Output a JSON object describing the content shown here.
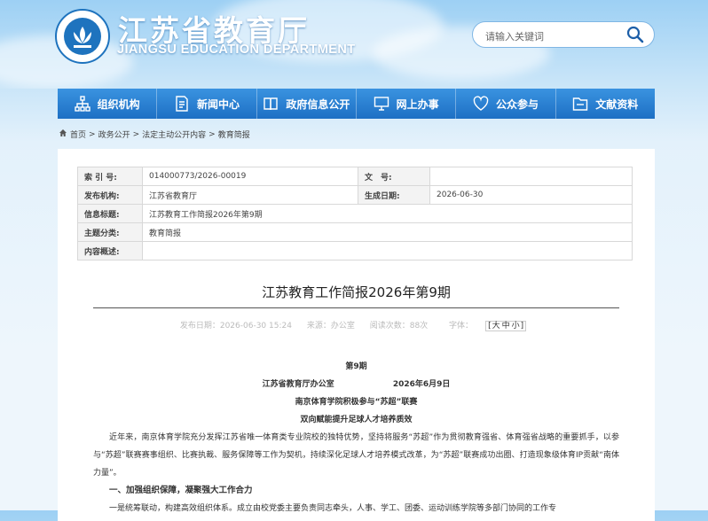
{
  "header": {
    "title": "江苏省教育厅",
    "subtitle": "JIANGSU EDUCATION DEPARTMENT",
    "search_placeholder": "请输入关键词"
  },
  "nav": {
    "items": [
      {
        "label": "组织机构",
        "icon": "org-chart-icon"
      },
      {
        "label": "新闻中心",
        "icon": "document-icon"
      },
      {
        "label": "政府信息公开",
        "icon": "book-icon"
      },
      {
        "label": "网上办事",
        "icon": "monitor-icon"
      },
      {
        "label": "公众参与",
        "icon": "heart-icon"
      },
      {
        "label": "文献资料",
        "icon": "folder-icon"
      }
    ]
  },
  "breadcrumb": [
    "首页",
    "政务公开",
    "法定主动公开内容",
    "教育简报"
  ],
  "meta": {
    "index_label": "索 引 号:",
    "index_value": "014000773/2026-00019",
    "doc_no_label": "文　号:",
    "doc_no_value": "",
    "org_label": "发布机构:",
    "org_value": "江苏省教育厅",
    "date_label": "生成日期:",
    "date_value": "2026-06-30",
    "title_label": "信息标题:",
    "title_value": "江苏教育工作简报2026年第9期",
    "topic_label": "主题分类:",
    "topic_value": "教育简报",
    "summary_label": "内容概述:",
    "summary_value": ""
  },
  "article": {
    "title": "江苏教育工作简报2026年第9期",
    "publish_time": "发布日期：2026-06-30 15:24",
    "source": "来源：办公室",
    "views": "阅读次数：88次",
    "font_label": "字体：",
    "font_sizes": [
      "大",
      "中",
      "小"
    ],
    "issue": "第9期",
    "office": "江苏省教育厅办公室",
    "issue_date": "2026年6月9日",
    "headline": "南京体育学院积极参与“苏超”联赛",
    "subheadline": "双向赋能提升足球人才培养质效",
    "para1": "近年来，南京体育学院充分发挥江苏省唯一体育类专业院校的独特优势，坚持将服务“苏超”作为贯彻教育强省、体育强省战略的重要抓手，以参与“苏超”联赛赛事组织、比赛执裁、服务保障等工作为契机，持续深化足球人才培养模式改革，为“苏超”联赛成功出圈、打造现象级体育IP贡献“南体力量”。",
    "section1": "一、加强组织保障，凝聚强大工作合力",
    "para2": "一是统筹联动，构建高效组织体系。成立由校党委主要负责同志牵头，人事、学工、团委、运动训练学院等多部门协同的工作专"
  }
}
